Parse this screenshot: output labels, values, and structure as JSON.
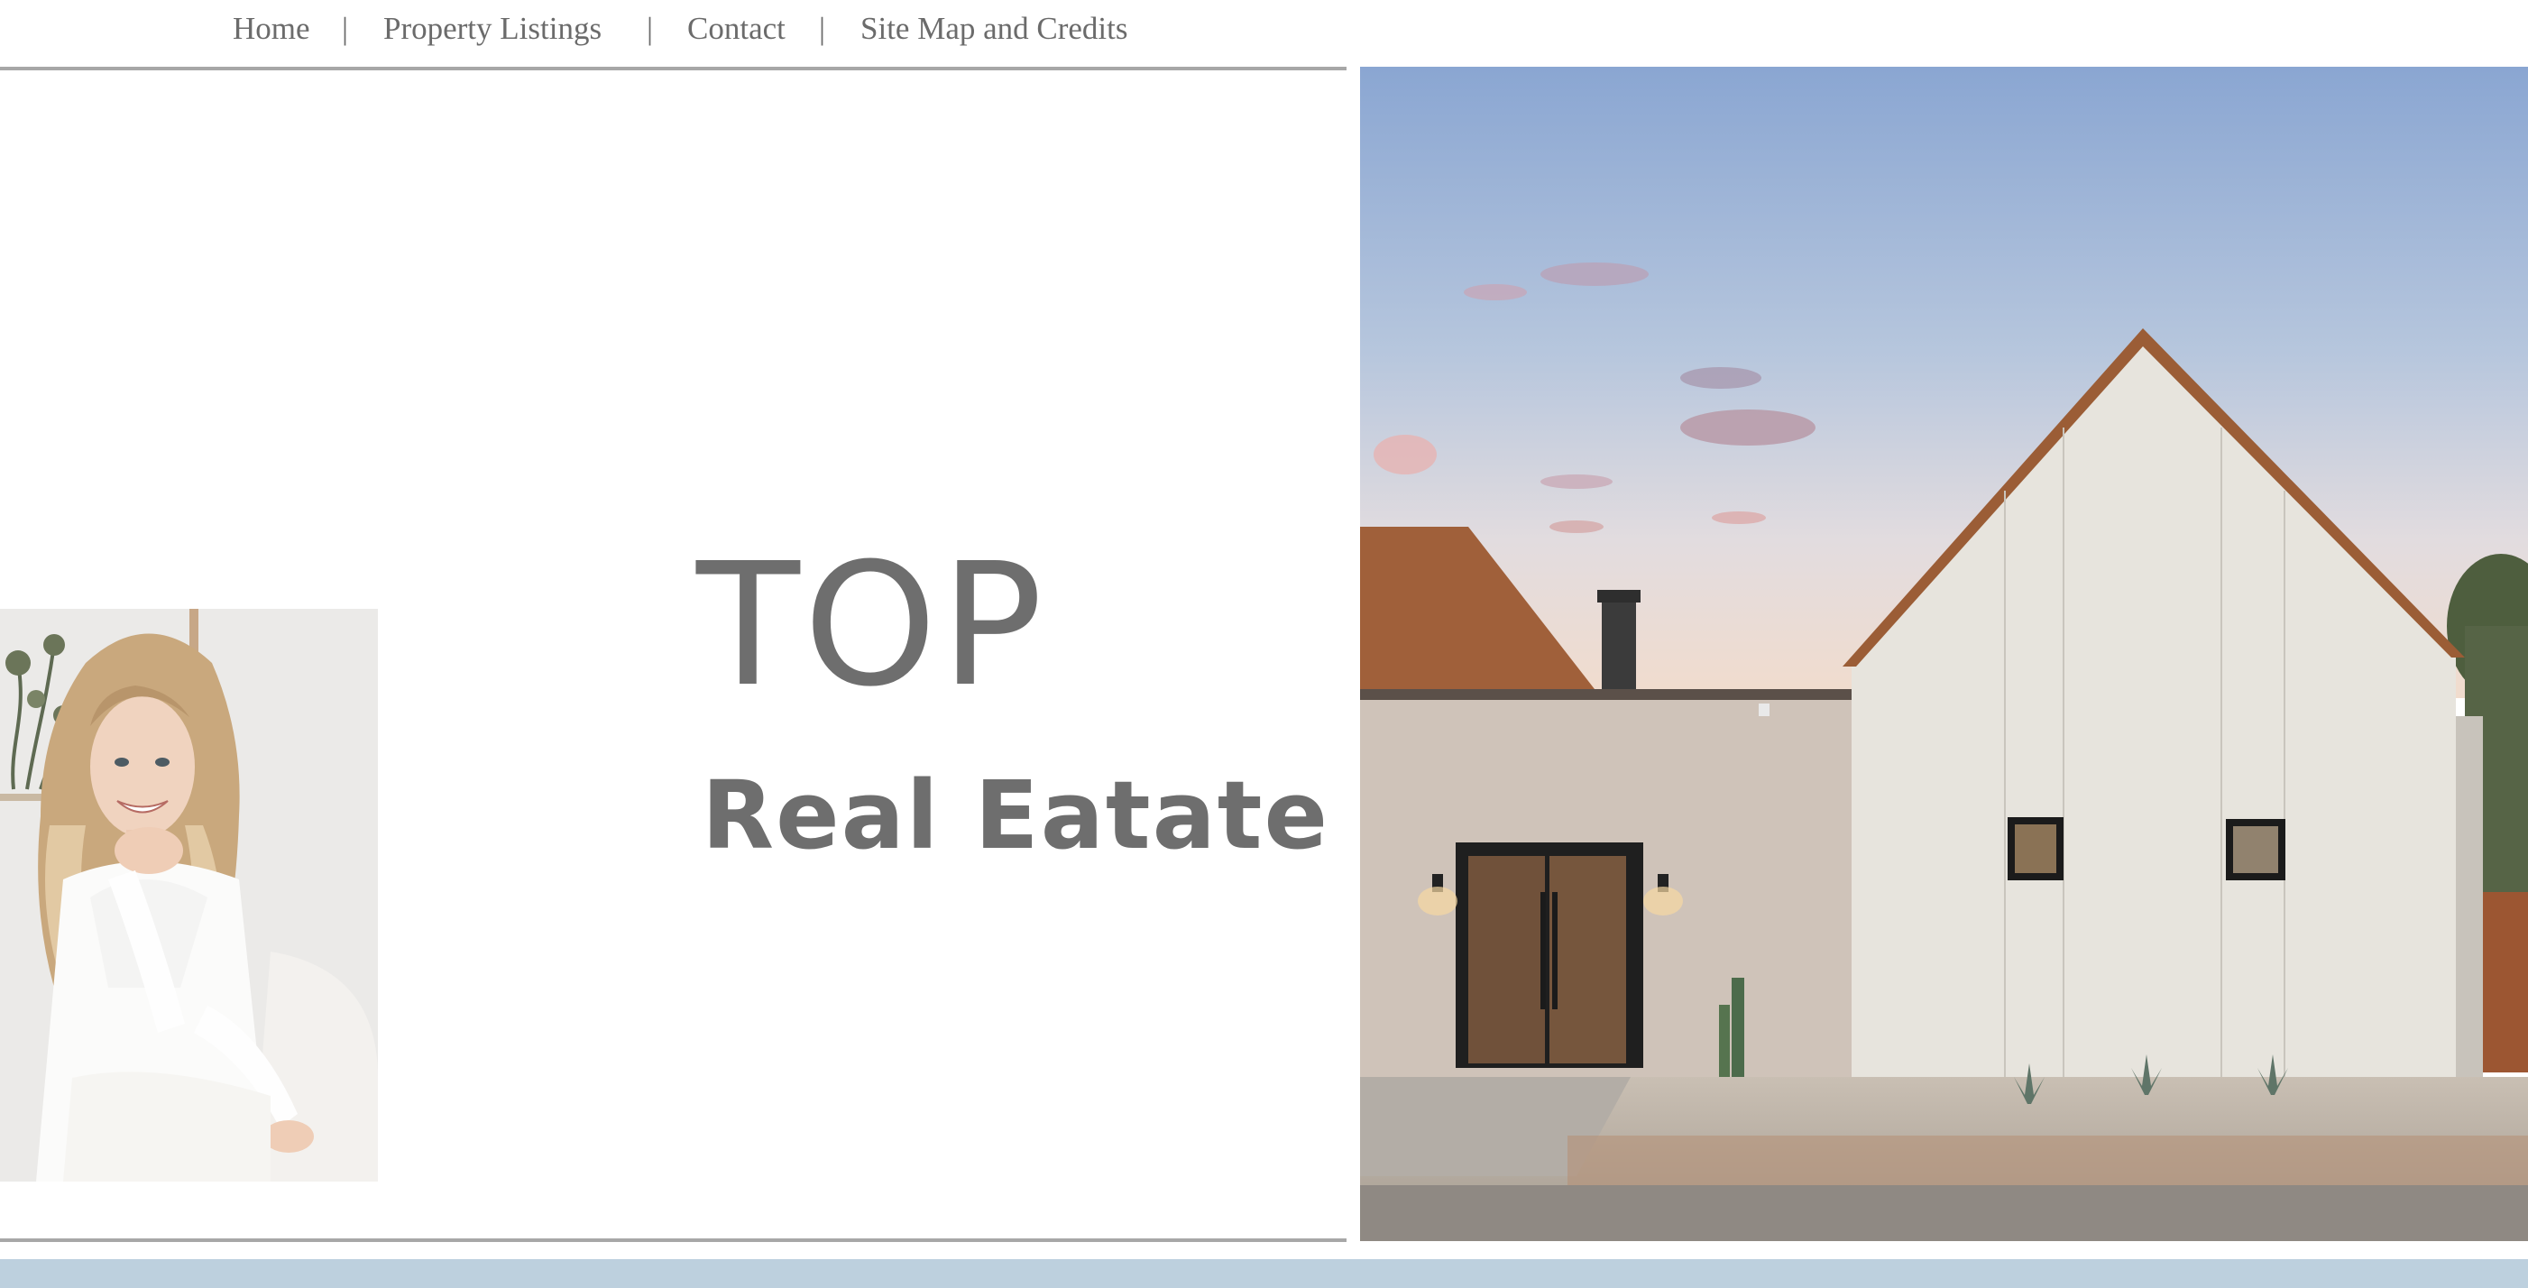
{
  "nav": {
    "items": [
      {
        "label": "Home"
      },
      {
        "label": "Property Listings"
      },
      {
        "label": "Contact"
      },
      {
        "label": "Site Map and Credits"
      }
    ],
    "separator": "|"
  },
  "hero": {
    "title": "TOP",
    "subtitle": "Real Eatate"
  },
  "images": {
    "agent": "portrait of smiling blonde woman in white outfit",
    "house": "white gabled house with brick wing and wooden door at dusk"
  },
  "colors": {
    "text_gray": "#6e6e6e",
    "rule_gray": "#a7a7a7",
    "footer_band": "#bdd0de",
    "sky_top": "#8fa9d3"
  }
}
